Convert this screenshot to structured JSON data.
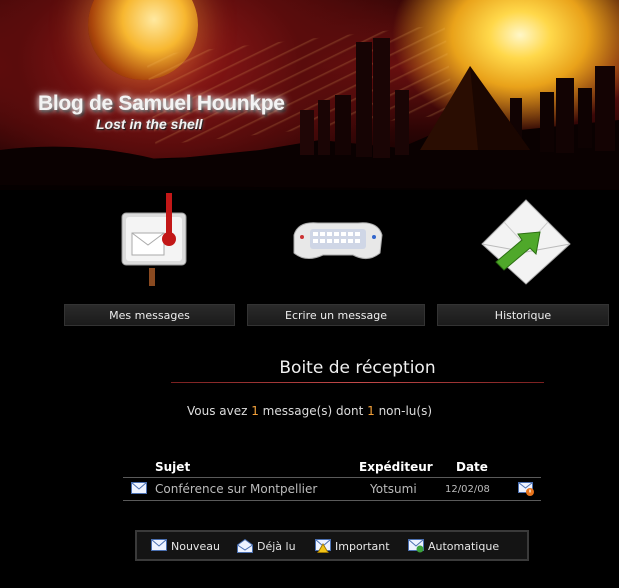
{
  "header": {
    "title": "Blog de Samuel Hounkpe",
    "subtitle": "Lost in the shell"
  },
  "nav": [
    {
      "label": "Mes messages",
      "icon": "mailbox-icon"
    },
    {
      "label": "Ecrire un message",
      "icon": "keyboard-icon"
    },
    {
      "label": "Historique",
      "icon": "envelope-send-icon"
    }
  ],
  "inbox": {
    "title": "Boite de réception",
    "summary": {
      "prefix": "Vous avez ",
      "total": "1",
      "middle": " message(s) dont ",
      "unread": "1",
      "suffix": " non-lu(s)"
    },
    "columns": {
      "subject": "Sujet",
      "sender": "Expéditeur",
      "date": "Date"
    },
    "messages": [
      {
        "subject": "Conférence sur Montpellier",
        "sender": "Yotsumi",
        "date": "12/02/08",
        "status_icon": "new-mail-icon",
        "flag_icon": "important-mail-icon"
      }
    ]
  },
  "legend": [
    {
      "label": "Nouveau",
      "icon": "new-mail-icon"
    },
    {
      "label": "Déjà lu",
      "icon": "read-mail-icon"
    },
    {
      "label": "Important",
      "icon": "important-mail-icon"
    },
    {
      "label": "Automatique",
      "icon": "auto-mail-icon"
    }
  ],
  "colors": {
    "background": "#000000",
    "accent": "#f2a03a",
    "rule": "#c44a4a"
  }
}
